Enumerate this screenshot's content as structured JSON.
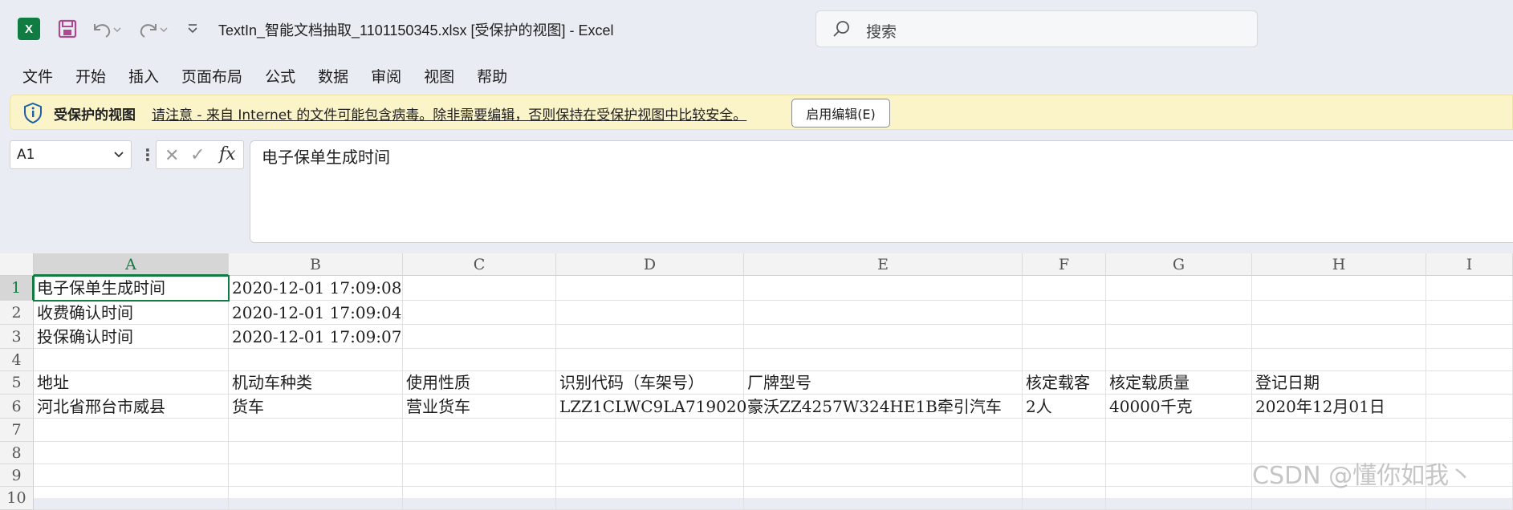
{
  "window": {
    "title": "TextIn_智能文档抽取_1101150345.xlsx  [受保护的视图]  -  Excel",
    "search_placeholder": "搜索"
  },
  "menu": [
    "文件",
    "开始",
    "插入",
    "页面布局",
    "公式",
    "数据",
    "审阅",
    "视图",
    "帮助"
  ],
  "protected_bar": {
    "label": "受保护的视图",
    "message": "请注意 - 来自 Internet 的文件可能包含病毒。除非需要编辑，否则保持在受保护视图中比较安全。",
    "enable_button": "启用编辑(E)"
  },
  "formula_bar": {
    "name_box": "A1",
    "fx": "fx",
    "content": "电子保单生成时间"
  },
  "sheet": {
    "columns": [
      "A",
      "B",
      "C",
      "D",
      "E",
      "F",
      "G",
      "H",
      "I"
    ],
    "rows": [
      "1",
      "2",
      "3",
      "4",
      "5",
      "6",
      "7",
      "8",
      "9",
      "10"
    ],
    "cells": [
      [
        "电子保单生成时间",
        "2020-12-01 17:09:08",
        "",
        "",
        "",
        "",
        "",
        "",
        ""
      ],
      [
        "收费确认时间",
        "2020-12-01 17:09:04",
        "",
        "",
        "",
        "",
        "",
        "",
        ""
      ],
      [
        "投保确认时间",
        "2020-12-01 17:09:07",
        "",
        "",
        "",
        "",
        "",
        "",
        ""
      ],
      [
        "",
        "",
        "",
        "",
        "",
        "",
        "",
        "",
        ""
      ],
      [
        "地址",
        "机动车种类",
        "使用性质",
        "识别代码（车架号）",
        "厂牌型号",
        "核定载客",
        "核定载质量",
        "登记日期",
        ""
      ],
      [
        "河北省邢台市威县",
        "货车",
        "营业货车",
        "LZZ1CLWC9LA719020",
        "豪沃ZZ4257W324HE1B牵引汽车",
        "2人",
        "40000千克",
        "2020年12月01日",
        ""
      ],
      [
        "",
        "",
        "",
        "",
        "",
        "",
        "",
        "",
        ""
      ],
      [
        "",
        "",
        "",
        "",
        "",
        "",
        "",
        "",
        ""
      ],
      [
        "",
        "",
        "",
        "",
        "",
        "",
        "",
        "",
        ""
      ],
      [
        "",
        "",
        "",
        "",
        "",
        "",
        "",
        "",
        ""
      ]
    ],
    "active_cell": "A1"
  },
  "watermark": "CSDN @懂你如我丶"
}
